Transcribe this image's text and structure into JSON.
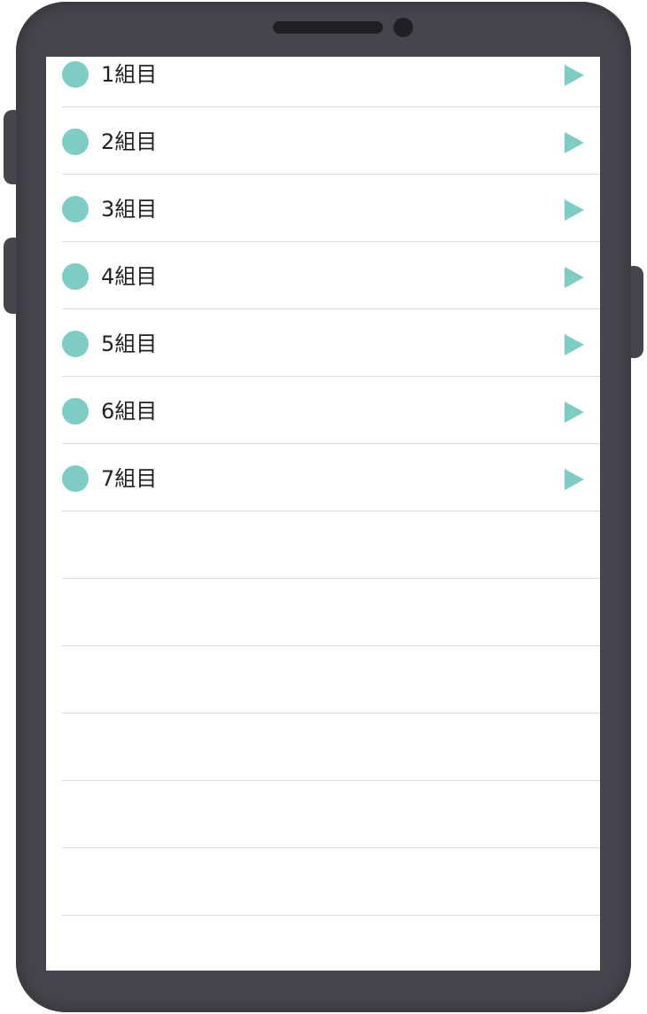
{
  "accent_color": "#7ecdc4",
  "list": {
    "items": [
      {
        "label": "1組目",
        "bullet_icon": "dot-icon",
        "trailing_icon": "chevron-right-icon"
      },
      {
        "label": "2組目",
        "bullet_icon": "dot-icon",
        "trailing_icon": "chevron-right-icon"
      },
      {
        "label": "3組目",
        "bullet_icon": "dot-icon",
        "trailing_icon": "chevron-right-icon"
      },
      {
        "label": "4組目",
        "bullet_icon": "dot-icon",
        "trailing_icon": "chevron-right-icon"
      },
      {
        "label": "5組目",
        "bullet_icon": "dot-icon",
        "trailing_icon": "chevron-right-icon"
      },
      {
        "label": "6組目",
        "bullet_icon": "dot-icon",
        "trailing_icon": "chevron-right-icon"
      },
      {
        "label": "7組目",
        "bullet_icon": "dot-icon",
        "trailing_icon": "chevron-right-icon"
      }
    ]
  }
}
